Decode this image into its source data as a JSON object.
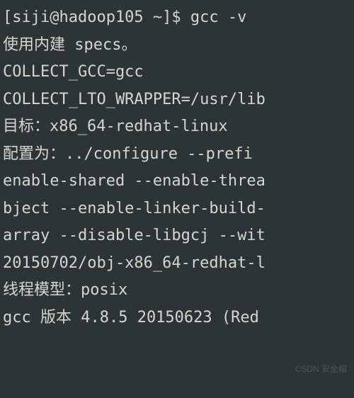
{
  "terminal": {
    "lines": [
      "[siji@hadoop105 ~]$ gcc -v",
      "使用内建 specs。",
      "COLLECT_GCC=gcc",
      "COLLECT_LTO_WRAPPER=/usr/lib",
      "目标：x86_64-redhat-linux",
      "配置为：../configure --prefi",
      "enable-shared --enable-threa",
      "bject --enable-linker-build-",
      "array --disable-libgcj --wit",
      "20150702/obj-x86_64-redhat-l",
      "线程模型：posix",
      "gcc 版本 4.8.5 20150623 (Red"
    ]
  },
  "watermark": "CSDN 安全帽"
}
